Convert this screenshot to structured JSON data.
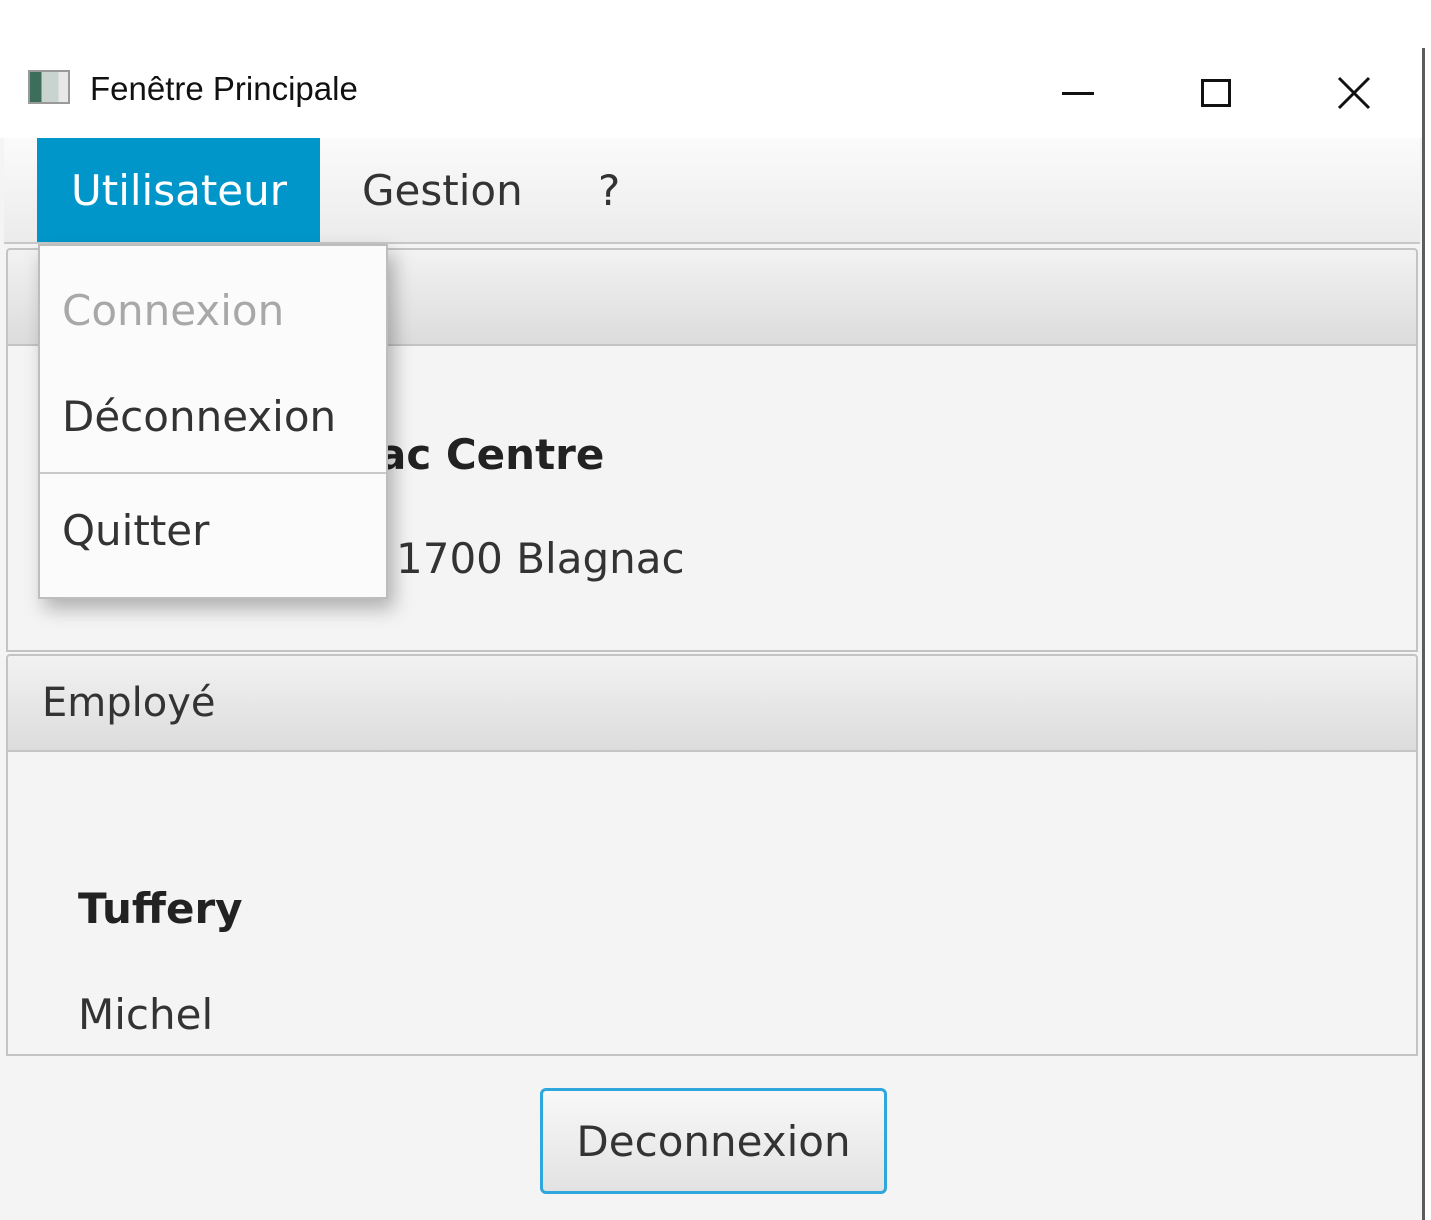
{
  "window": {
    "title": "Fenêtre Principale"
  },
  "menubar": {
    "items": [
      {
        "label": "Utilisateur"
      },
      {
        "label": "Gestion"
      },
      {
        "label": "?"
      }
    ]
  },
  "dropdown": {
    "items": [
      {
        "label": "Connexion",
        "enabled": false
      },
      {
        "label": "Déconnexion",
        "enabled": true
      },
      {
        "label": "Quitter",
        "enabled": true
      }
    ]
  },
  "agency": {
    "name_visible": "ac Centre",
    "address_visible": "1700 Blagnac"
  },
  "employee": {
    "pane_title": "Employé",
    "lastname": "Tuffery",
    "firstname": "Michel"
  },
  "actions": {
    "deconnexion_label": "Deconnexion"
  },
  "colors": {
    "menu_active_bg": "#0096c9",
    "button_focus_border": "#2fa6dc"
  }
}
